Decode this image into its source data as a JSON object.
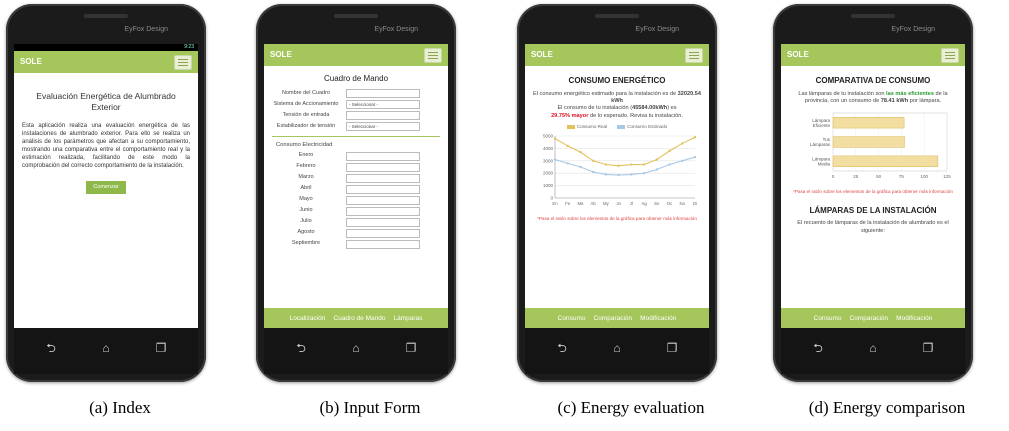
{
  "colors": {
    "accent": "#a4c65a",
    "real": "#e3c15c",
    "estimated": "#a8c9e6",
    "bar": "#f1dea0"
  },
  "common": {
    "brand": "EyFox Design",
    "app_title": "SOLE"
  },
  "screens": [
    {
      "caption": "(a) Index",
      "status": "9:23",
      "heading": "Evaluación Energética de Alumbrado Exterior",
      "body": "Esta aplicación realiza una evaluación energética de las instalaciones de alumbrado exterior. Para ello se realiza un análisis de los parámetros que afectan a su comportamiento, mostrando una comparativa entre el comportamiento real y la estimación realizada, facilitando de este modo la comprobación del correcto comportamiento de la instalación.",
      "button": "Comenzar"
    },
    {
      "caption": "(b) Input Form",
      "heading": "Cuadro de Mando",
      "fields": [
        {
          "label": "Nombre del Cuadro",
          "value": ""
        },
        {
          "label": "Sistema de Accionamiento",
          "value": "- Seleccionar -"
        },
        {
          "label": "Tensión de entrada",
          "value": ""
        },
        {
          "label": "Estabilizador de tensión",
          "value": "- Seleccionar -"
        }
      ],
      "section": "Consumo Electricidad",
      "months": [
        "Enero",
        "Febrero",
        "Marzo",
        "Abril",
        "Mayo",
        "Junio",
        "Julio",
        "Agosto",
        "Septiembre"
      ],
      "footer": [
        "Localización",
        "Cuadro de Mando",
        "Lámparas"
      ]
    },
    {
      "caption": "(c) Energy evaluation",
      "title": "CONSUMO ENERGÉTICO",
      "line1": "El consumo energético estimado para la instalación es de",
      "value1": "32020.54 kWh",
      "line2a": "El consumo de tu instalación (",
      "value2": "45584.00kWh",
      "line2b": ") es",
      "value3": "29.75% mayor",
      "line3": "de lo esperado. Revisa tu instalación.",
      "legend": [
        "Consumo Real",
        "Consumo Estimado"
      ],
      "note": "*Pasa el ratón sobre los elementos de la gráfica para obtener más información",
      "footer": [
        "Consumo",
        "Comparación",
        "Modificación"
      ]
    },
    {
      "caption": "(d) Energy comparison",
      "title": "COMPARATIVA DE CONSUMO",
      "line1": "Las lámparas de tu instalación son",
      "highlight": "las más eficientes",
      "line2": "de la provincia, con un consumo de",
      "value": "78.41 kWh",
      "line3": "por lámpara.",
      "note": "*Pasa el ratón sobre los elementos de la gráfica para obtener más información",
      "title2": "LÁMPARAS DE LA INSTALACIÓN",
      "line4": "El recuento de lámparas de la instalación de alumbrado es el siguiente:",
      "footer": [
        "Consumo",
        "Comparación",
        "Modificación"
      ]
    }
  ],
  "chart_data": [
    {
      "type": "line",
      "categories": [
        "En",
        "Fe",
        "Ma",
        "Ab",
        "My",
        "Jn",
        "Jl",
        "Ag",
        "Se",
        "Oc",
        "No",
        "Di"
      ],
      "series": [
        {
          "name": "Consumo Real",
          "values": [
            4800,
            4200,
            3700,
            3000,
            2700,
            2600,
            2700,
            2700,
            3100,
            3800,
            4400,
            4900
          ]
        },
        {
          "name": "Consumo Estimado",
          "values": [
            3100,
            2800,
            2500,
            2100,
            1900,
            1850,
            1900,
            2000,
            2300,
            2700,
            3000,
            3300
          ]
        }
      ],
      "ylim": [
        0,
        5000
      ],
      "yticks": [
        0,
        1000,
        2000,
        3000,
        4000,
        5000
      ]
    },
    {
      "type": "bar",
      "orientation": "horizontal",
      "categories": [
        "Lámpara Eficiente",
        "Tus Lámparas",
        "Lámpara Media"
      ],
      "values": [
        78,
        78.41,
        115
      ],
      "xlim": [
        0,
        125
      ],
      "xticks": [
        0,
        25,
        50,
        75,
        100,
        125
      ]
    }
  ]
}
